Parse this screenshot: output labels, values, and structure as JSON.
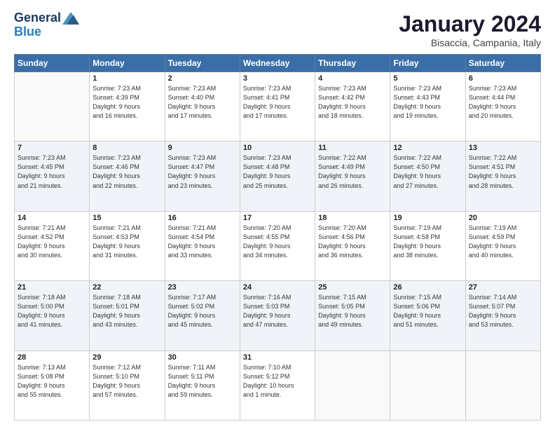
{
  "logo": {
    "general": "General",
    "blue": "Blue"
  },
  "title": "January 2024",
  "location": "Bisaccia, Campania, Italy",
  "headers": [
    "Sunday",
    "Monday",
    "Tuesday",
    "Wednesday",
    "Thursday",
    "Friday",
    "Saturday"
  ],
  "weeks": [
    [
      {
        "day": "",
        "info": ""
      },
      {
        "day": "1",
        "info": "Sunrise: 7:23 AM\nSunset: 4:39 PM\nDaylight: 9 hours\nand 16 minutes."
      },
      {
        "day": "2",
        "info": "Sunrise: 7:23 AM\nSunset: 4:40 PM\nDaylight: 9 hours\nand 17 minutes."
      },
      {
        "day": "3",
        "info": "Sunrise: 7:23 AM\nSunset: 4:41 PM\nDaylight: 9 hours\nand 17 minutes."
      },
      {
        "day": "4",
        "info": "Sunrise: 7:23 AM\nSunset: 4:42 PM\nDaylight: 9 hours\nand 18 minutes."
      },
      {
        "day": "5",
        "info": "Sunrise: 7:23 AM\nSunset: 4:43 PM\nDaylight: 9 hours\nand 19 minutes."
      },
      {
        "day": "6",
        "info": "Sunrise: 7:23 AM\nSunset: 4:44 PM\nDaylight: 9 hours\nand 20 minutes."
      }
    ],
    [
      {
        "day": "7",
        "info": "Sunrise: 7:23 AM\nSunset: 4:45 PM\nDaylight: 9 hours\nand 21 minutes."
      },
      {
        "day": "8",
        "info": "Sunrise: 7:23 AM\nSunset: 4:46 PM\nDaylight: 9 hours\nand 22 minutes."
      },
      {
        "day": "9",
        "info": "Sunrise: 7:23 AM\nSunset: 4:47 PM\nDaylight: 9 hours\nand 23 minutes."
      },
      {
        "day": "10",
        "info": "Sunrise: 7:23 AM\nSunset: 4:48 PM\nDaylight: 9 hours\nand 25 minutes."
      },
      {
        "day": "11",
        "info": "Sunrise: 7:22 AM\nSunset: 4:49 PM\nDaylight: 9 hours\nand 26 minutes."
      },
      {
        "day": "12",
        "info": "Sunrise: 7:22 AM\nSunset: 4:50 PM\nDaylight: 9 hours\nand 27 minutes."
      },
      {
        "day": "13",
        "info": "Sunrise: 7:22 AM\nSunset: 4:51 PM\nDaylight: 9 hours\nand 28 minutes."
      }
    ],
    [
      {
        "day": "14",
        "info": "Sunrise: 7:21 AM\nSunset: 4:52 PM\nDaylight: 9 hours\nand 30 minutes."
      },
      {
        "day": "15",
        "info": "Sunrise: 7:21 AM\nSunset: 4:53 PM\nDaylight: 9 hours\nand 31 minutes."
      },
      {
        "day": "16",
        "info": "Sunrise: 7:21 AM\nSunset: 4:54 PM\nDaylight: 9 hours\nand 33 minutes."
      },
      {
        "day": "17",
        "info": "Sunrise: 7:20 AM\nSunset: 4:55 PM\nDaylight: 9 hours\nand 34 minutes."
      },
      {
        "day": "18",
        "info": "Sunrise: 7:20 AM\nSunset: 4:56 PM\nDaylight: 9 hours\nand 36 minutes."
      },
      {
        "day": "19",
        "info": "Sunrise: 7:19 AM\nSunset: 4:58 PM\nDaylight: 9 hours\nand 38 minutes."
      },
      {
        "day": "20",
        "info": "Sunrise: 7:19 AM\nSunset: 4:59 PM\nDaylight: 9 hours\nand 40 minutes."
      }
    ],
    [
      {
        "day": "21",
        "info": "Sunrise: 7:18 AM\nSunset: 5:00 PM\nDaylight: 9 hours\nand 41 minutes."
      },
      {
        "day": "22",
        "info": "Sunrise: 7:18 AM\nSunset: 5:01 PM\nDaylight: 9 hours\nand 43 minutes."
      },
      {
        "day": "23",
        "info": "Sunrise: 7:17 AM\nSunset: 5:02 PM\nDaylight: 9 hours\nand 45 minutes."
      },
      {
        "day": "24",
        "info": "Sunrise: 7:16 AM\nSunset: 5:03 PM\nDaylight: 9 hours\nand 47 minutes."
      },
      {
        "day": "25",
        "info": "Sunrise: 7:15 AM\nSunset: 5:05 PM\nDaylight: 9 hours\nand 49 minutes."
      },
      {
        "day": "26",
        "info": "Sunrise: 7:15 AM\nSunset: 5:06 PM\nDaylight: 9 hours\nand 51 minutes."
      },
      {
        "day": "27",
        "info": "Sunrise: 7:14 AM\nSunset: 5:07 PM\nDaylight: 9 hours\nand 53 minutes."
      }
    ],
    [
      {
        "day": "28",
        "info": "Sunrise: 7:13 AM\nSunset: 5:08 PM\nDaylight: 9 hours\nand 55 minutes."
      },
      {
        "day": "29",
        "info": "Sunrise: 7:12 AM\nSunset: 5:10 PM\nDaylight: 9 hours\nand 57 minutes."
      },
      {
        "day": "30",
        "info": "Sunrise: 7:11 AM\nSunset: 5:11 PM\nDaylight: 9 hours\nand 59 minutes."
      },
      {
        "day": "31",
        "info": "Sunrise: 7:10 AM\nSunset: 5:12 PM\nDaylight: 10 hours\nand 1 minute."
      },
      {
        "day": "",
        "info": ""
      },
      {
        "day": "",
        "info": ""
      },
      {
        "day": "",
        "info": ""
      }
    ]
  ]
}
